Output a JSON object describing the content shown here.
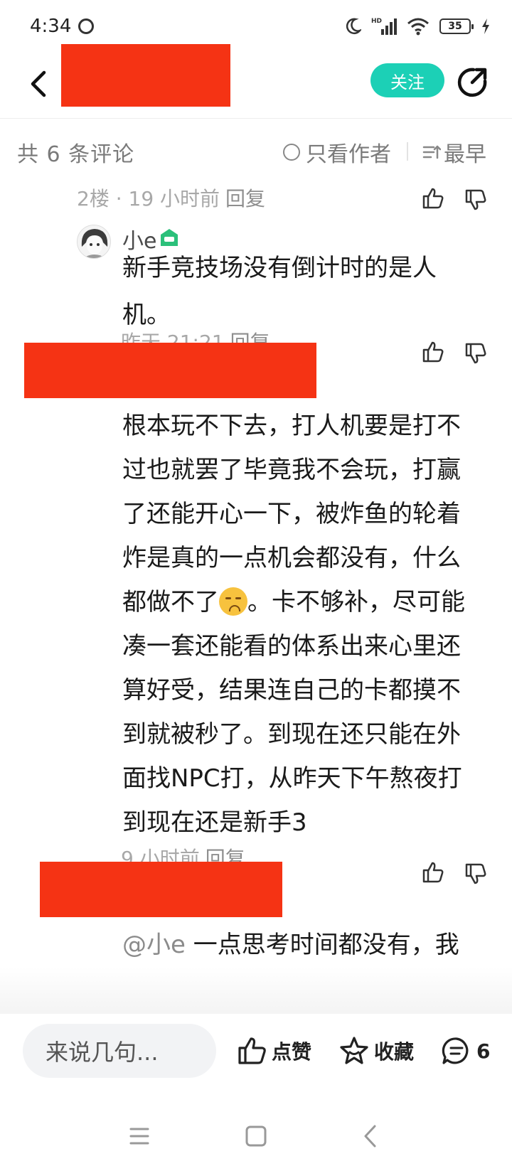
{
  "status_bar": {
    "time": "4:34",
    "battery": "35"
  },
  "header": {
    "follow_label": "关注"
  },
  "comment_header": {
    "count_label": "共 6 条评论",
    "author_only_label": "只看作者",
    "sort_label": "最早"
  },
  "comments": [
    {
      "meta": "2楼 · 19 小时前",
      "reply_label": "回复"
    },
    {
      "username": "小e",
      "text": "新手竞技场没有倒计时的是人机。",
      "time": "昨天 21:21",
      "reply_label": "回复"
    },
    {
      "text_part1": "根本玩不下去，打人机要是打不过也就罢了毕竟我不会玩，打赢了还能开心一下，被炸鱼的轮着炸是真的一点机会都没有，什么都做不了",
      "text_part2": "。卡不够补，尽可能凑一套还能看的体系出来心里还算好受，结果连自己的卡都摸不到就被秒了。到现在还只能在外面找NPC打，从昨天下午熬夜打到现在还是新手3",
      "time": "9 小时前",
      "reply_label": "回复"
    },
    {
      "mention": "@小e",
      "text": " 一点思考时间都没有，我还是能看出来真人和人机的"
    }
  ],
  "bottom_bar": {
    "input_placeholder": "来说几句...",
    "like_label": "点赞",
    "favorite_label": "收藏",
    "comment_count": "6"
  },
  "colors": {
    "accent": "#1cd0b6",
    "redaction": "#f53314"
  }
}
